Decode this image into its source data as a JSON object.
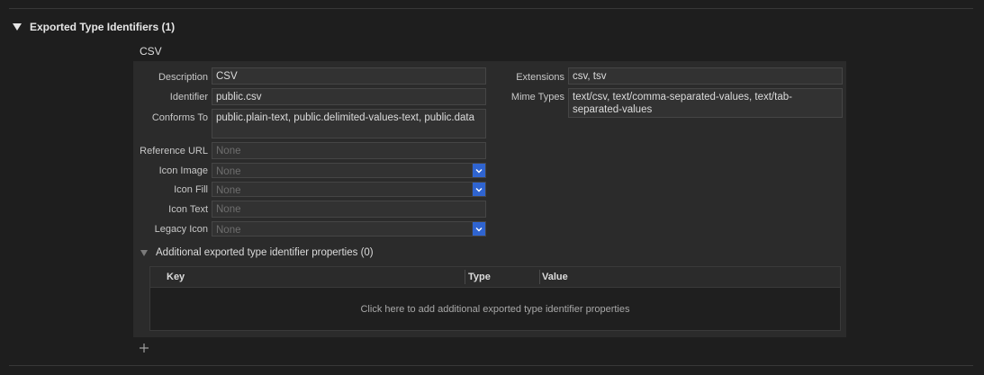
{
  "section": {
    "title": "Exported Type Identifiers (1)"
  },
  "type_entry": {
    "name": "CSV",
    "fields": {
      "description": {
        "label": "Description",
        "value": "CSV"
      },
      "identifier": {
        "label": "Identifier",
        "value": "public.csv"
      },
      "conforms_to": {
        "label": "Conforms To",
        "value": "public.plain-text, public.delimited-values-text, public.data"
      },
      "reference_url": {
        "label": "Reference URL",
        "placeholder": "None"
      },
      "icon_image": {
        "label": "Icon Image",
        "placeholder": "None"
      },
      "icon_fill": {
        "label": "Icon Fill",
        "placeholder": "None"
      },
      "icon_text": {
        "label": "Icon Text",
        "placeholder": "None"
      },
      "legacy_icon": {
        "label": "Legacy Icon",
        "placeholder": "None"
      },
      "extensions": {
        "label": "Extensions",
        "value": "csv, tsv"
      },
      "mime_types": {
        "label": "Mime Types",
        "value": "text/csv, text/comma-separated-values, text/tab-separated-values"
      }
    },
    "additional": {
      "title": "Additional exported type identifier properties (0)",
      "columns": [
        "Key",
        "Type",
        "Value"
      ],
      "empty_message": "Click here to add additional exported type identifier properties"
    }
  },
  "icons": {
    "section_toggle": "disclosure-triangle-down-icon",
    "additional_toggle": "disclosure-triangle-down-icon",
    "popup": "chevron-down-icon",
    "add": "plus-icon"
  },
  "colors": {
    "background": "#1e1e1e",
    "panel": "#2b2b2b",
    "accent": "#2f64d0"
  }
}
